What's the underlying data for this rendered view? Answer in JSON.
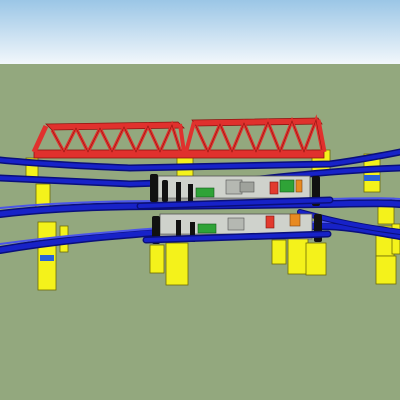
{
  "scene": {
    "sky_color_top": "#9bc6e6",
    "sky_color_bottom": "#f2f7fb",
    "ground_color": "#93a87e",
    "track_color": "#1722c8",
    "track_dark": "#0a0f7a",
    "truss_color": "#e0312d",
    "truss_dark": "#8e1410",
    "pier_color": "#f4f21b",
    "pier_dark": "#b5b20c",
    "pier_band": "#2a63d8",
    "module_parts": [
      "green-switch",
      "gray-gear",
      "red-relay",
      "orange-relay",
      "black-post"
    ],
    "icons": [
      "truss-bridge-icon",
      "rail-track-icon",
      "pier-block-icon",
      "circuit-module-icon"
    ]
  }
}
